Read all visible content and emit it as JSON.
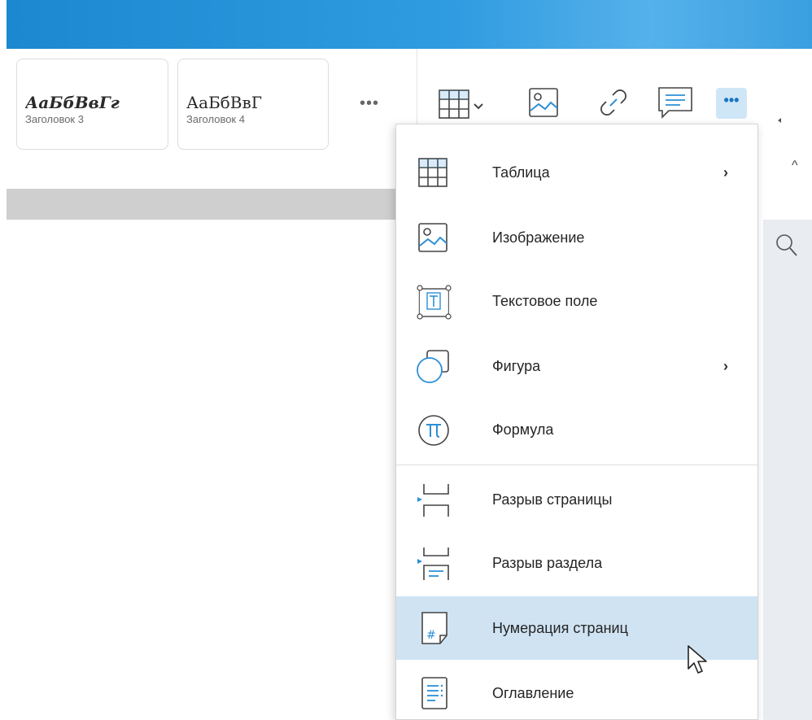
{
  "styles_gallery": {
    "cards": [
      {
        "sample": "АаБбВвГг",
        "label": "Заголовок 3"
      },
      {
        "sample": "АаБбВвГ",
        "label": "Заголовок 4"
      }
    ],
    "more_label": "•••"
  },
  "toolbar": {
    "icons": [
      "table-icon",
      "image-icon",
      "link-icon",
      "comment-icon",
      "more-icon"
    ],
    "more_label": "•••",
    "accent": "#1a74be"
  },
  "insert_menu": {
    "items": [
      {
        "label": "Таблица",
        "icon": "table-icon",
        "submenu": true
      },
      {
        "label": "Изображение",
        "icon": "image-icon",
        "submenu": false
      },
      {
        "label": "Текстовое поле",
        "icon": "text-field-icon",
        "submenu": false
      },
      {
        "label": "Фигура",
        "icon": "shape-icon",
        "submenu": true
      },
      {
        "label": "Формула",
        "icon": "formula-icon",
        "submenu": false
      },
      {
        "label": "Разрыв страницы",
        "icon": "page-break-icon",
        "submenu": false
      },
      {
        "label": "Разрыв раздела",
        "icon": "section-break-icon",
        "submenu": false
      },
      {
        "label": "Нумерация страниц",
        "icon": "page-numbering-icon",
        "submenu": false,
        "highlighted": true
      },
      {
        "label": "Оглавление",
        "icon": "toc-icon",
        "submenu": false
      }
    ],
    "submenu_arrow": "›",
    "highlight_color": "#cfe3f3"
  },
  "colors": {
    "titlebar": "#1b88d0",
    "icon_blue": "#2c8fd6",
    "icon_dark": "#444444"
  }
}
